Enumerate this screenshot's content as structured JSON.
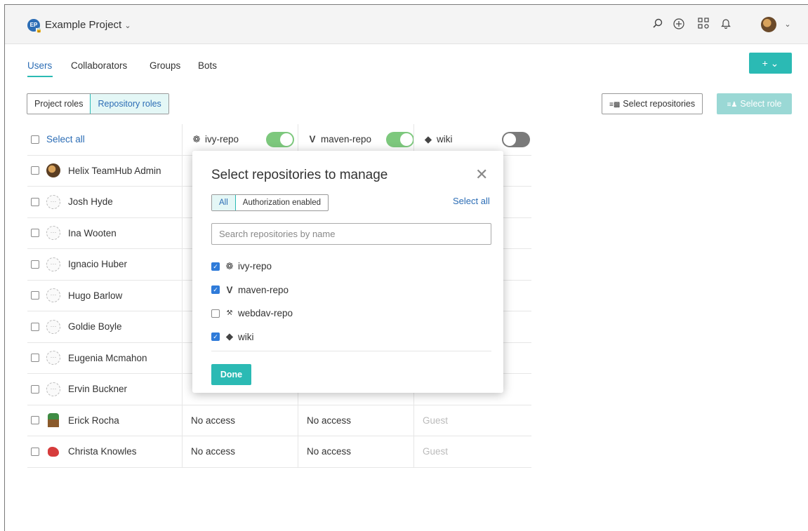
{
  "header": {
    "project_badge": "EP",
    "project_name": "Example Project",
    "icons": [
      "search-icon",
      "plus-circle-icon",
      "apps-grid-icon",
      "bell-icon",
      "user-avatar"
    ]
  },
  "tabs": [
    {
      "label": "Users",
      "active": true
    },
    {
      "label": "Collaborators",
      "active": false
    },
    {
      "label": "Groups",
      "active": false
    },
    {
      "label": "Bots",
      "active": false
    }
  ],
  "actions": {
    "add_label": "+ ⌄",
    "select_repositories": "Select repositories",
    "select_role": "Select role"
  },
  "role_tabs": {
    "project_roles": "Project roles",
    "repository_roles": "Repository roles"
  },
  "table": {
    "select_all": "Select all",
    "repos": [
      {
        "name": "ivy-repo",
        "icon": "ivy-icon",
        "enabled": true
      },
      {
        "name": "maven-repo",
        "icon": "maven-icon",
        "enabled": true
      },
      {
        "name": "wiki",
        "icon": "git-icon",
        "enabled": false
      }
    ],
    "rows": [
      {
        "name": "Helix TeamHub Admin",
        "avatar": "photo",
        "cells": [
          "",
          "",
          ""
        ]
      },
      {
        "name": "Josh Hyde",
        "avatar": "empty",
        "cells": [
          "",
          "",
          ""
        ]
      },
      {
        "name": "Ina Wooten",
        "avatar": "empty",
        "cells": [
          "",
          "",
          ""
        ]
      },
      {
        "name": "Ignacio Huber",
        "avatar": "empty",
        "cells": [
          "",
          "",
          ""
        ]
      },
      {
        "name": "Hugo Barlow",
        "avatar": "empty",
        "cells": [
          "",
          "",
          ""
        ]
      },
      {
        "name": "Goldie Boyle",
        "avatar": "empty",
        "cells": [
          "",
          "",
          ""
        ]
      },
      {
        "name": "Eugenia Mcmahon",
        "avatar": "empty",
        "cells": [
          "",
          "",
          ""
        ]
      },
      {
        "name": "Ervin Buckner",
        "avatar": "empty",
        "cells": [
          "",
          "",
          ""
        ]
      },
      {
        "name": "Erick Rocha",
        "avatar": "tree",
        "cells": [
          "No access",
          "No access",
          "Guest"
        ]
      },
      {
        "name": "Christa Knowles",
        "avatar": "red",
        "cells": [
          "No access",
          "No access",
          "Guest"
        ]
      }
    ]
  },
  "modal": {
    "title": "Select repositories to manage",
    "filter_all": "All",
    "filter_auth": "Authorization enabled",
    "select_all": "Select all",
    "search_placeholder": "Search repositories by name",
    "repos": [
      {
        "name": "ivy-repo",
        "icon": "ivy-icon",
        "checked": true
      },
      {
        "name": "maven-repo",
        "icon": "maven-icon",
        "checked": true
      },
      {
        "name": "webdav-repo",
        "icon": "webdav-icon",
        "checked": false
      },
      {
        "name": "wiki",
        "icon": "git-icon",
        "checked": true
      }
    ],
    "done_label": "Done"
  },
  "colors": {
    "accent": "#2bbab4",
    "link": "#2c6db5",
    "toggle_on": "#7dc87d",
    "toggle_off": "#7a7a7a"
  }
}
